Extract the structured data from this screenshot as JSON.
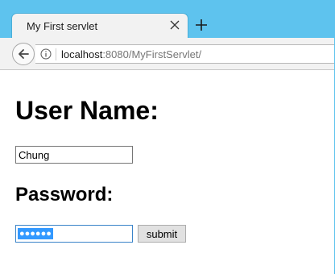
{
  "browser": {
    "tab": {
      "title": "My First servlet",
      "close_icon": "close-icon"
    },
    "new_tab_icon": "plus-icon",
    "toolbar": {
      "back_icon": "back-arrow-icon",
      "info_icon": "info-icon",
      "url_host": "localhost",
      "url_rest": ":8080/MyFirstServlet/"
    },
    "colors": {
      "titlebar": "#5ec3ee",
      "tab_bg": "#f2f2f2",
      "selection": "#3399ff"
    }
  },
  "page": {
    "username_heading": "User Name:",
    "username_value": "Chung",
    "password_heading": "Password:",
    "password_masked": "●●●●●●",
    "submit_label": "submit"
  }
}
